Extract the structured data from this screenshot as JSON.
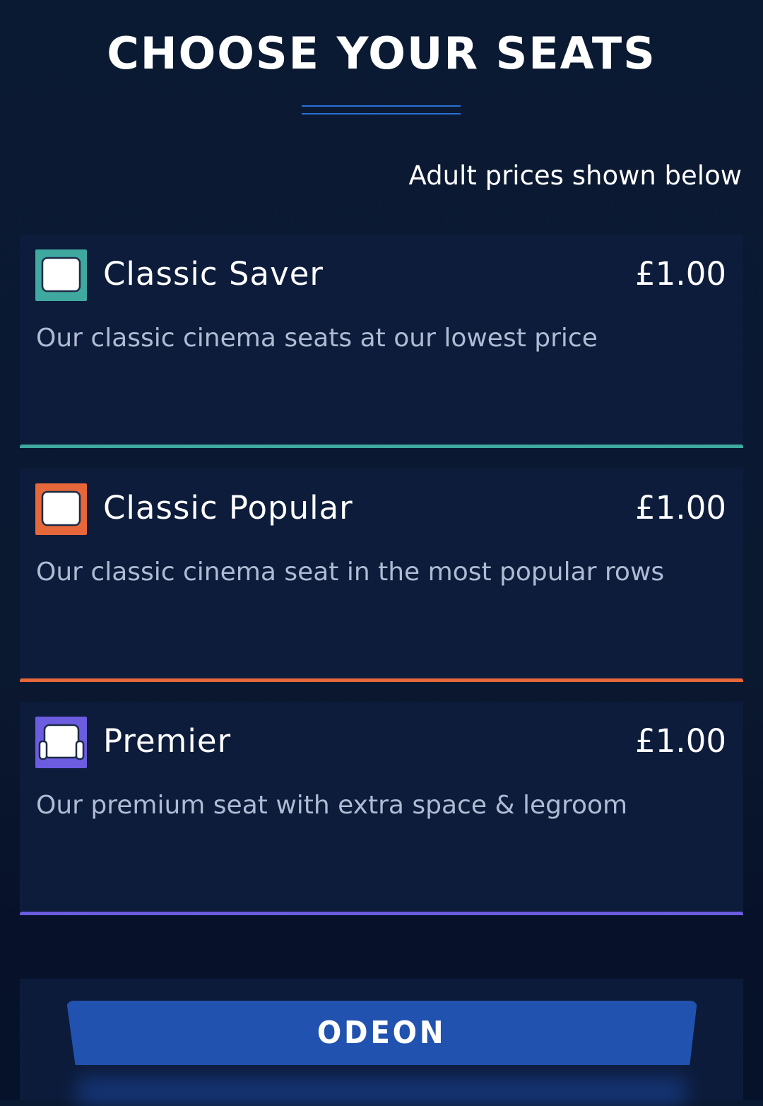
{
  "header": {
    "title": "CHOOSE YOUR SEATS",
    "price_note": "Adult prices shown below"
  },
  "seat_types": [
    {
      "name": "Classic Saver",
      "price": "£1.00",
      "description": "Our classic cinema seats at our lowest price",
      "accent_color": "#3fa9a0",
      "icon": "seat-icon"
    },
    {
      "name": "Classic Popular",
      "price": "£1.00",
      "description": "Our classic cinema seat in the most popular rows",
      "accent_color": "#e5673a",
      "icon": "seat-icon"
    },
    {
      "name": "Premier",
      "price": "£1.00",
      "description": "Our premium seat with extra space & legroom",
      "accent_color": "#6b5ce0",
      "icon": "armchair-icon"
    }
  ],
  "footer": {
    "brand": "ODEON"
  },
  "colors": {
    "background": "#0b1a33",
    "card_background": "#0d1c3b",
    "brand_blue": "#2152b0"
  }
}
